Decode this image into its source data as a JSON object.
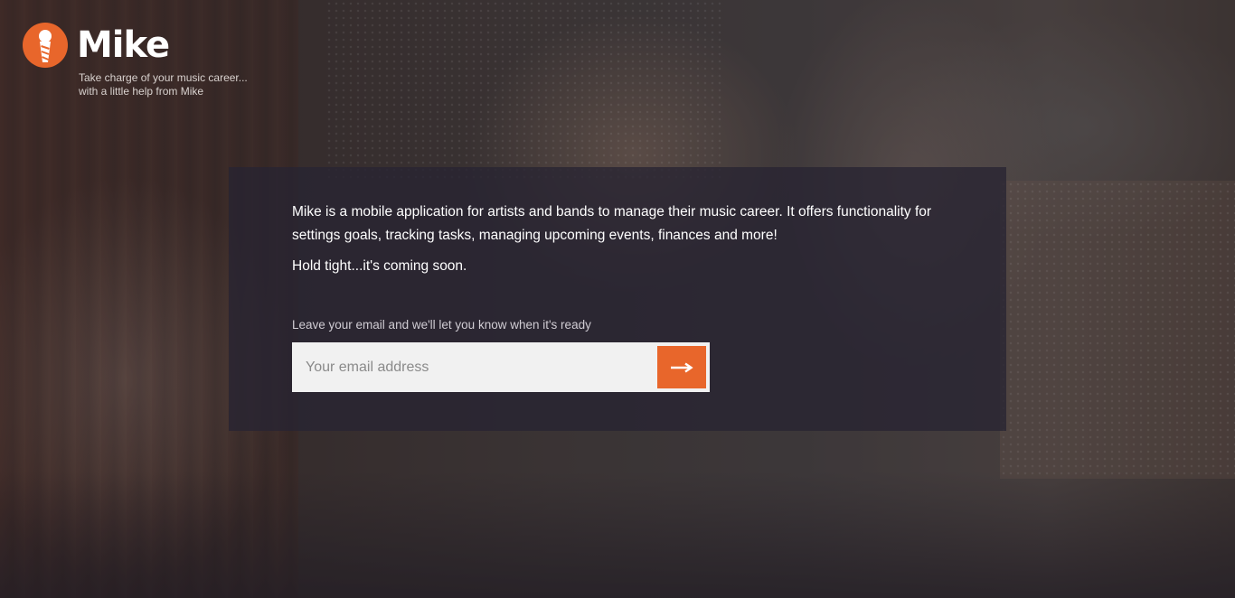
{
  "brand": {
    "name": "Mike",
    "tagline_line1": "Take charge of your music career...",
    "tagline_line2": "with a little help from Mike",
    "logo_icon": "microphone-icon",
    "accent_color": "#e8662b"
  },
  "content": {
    "description": "Mike is a mobile application for artists and bands to manage their music career. It offers functionality for settings goals, tracking tasks, managing upcoming events, finances and more!",
    "hold_text": "Hold tight...it's coming soon.",
    "email_label": "Leave your email and we'll let you know when it's ready",
    "email_placeholder": "Your email address",
    "email_value": "",
    "submit_icon": "arrow-right-icon"
  }
}
